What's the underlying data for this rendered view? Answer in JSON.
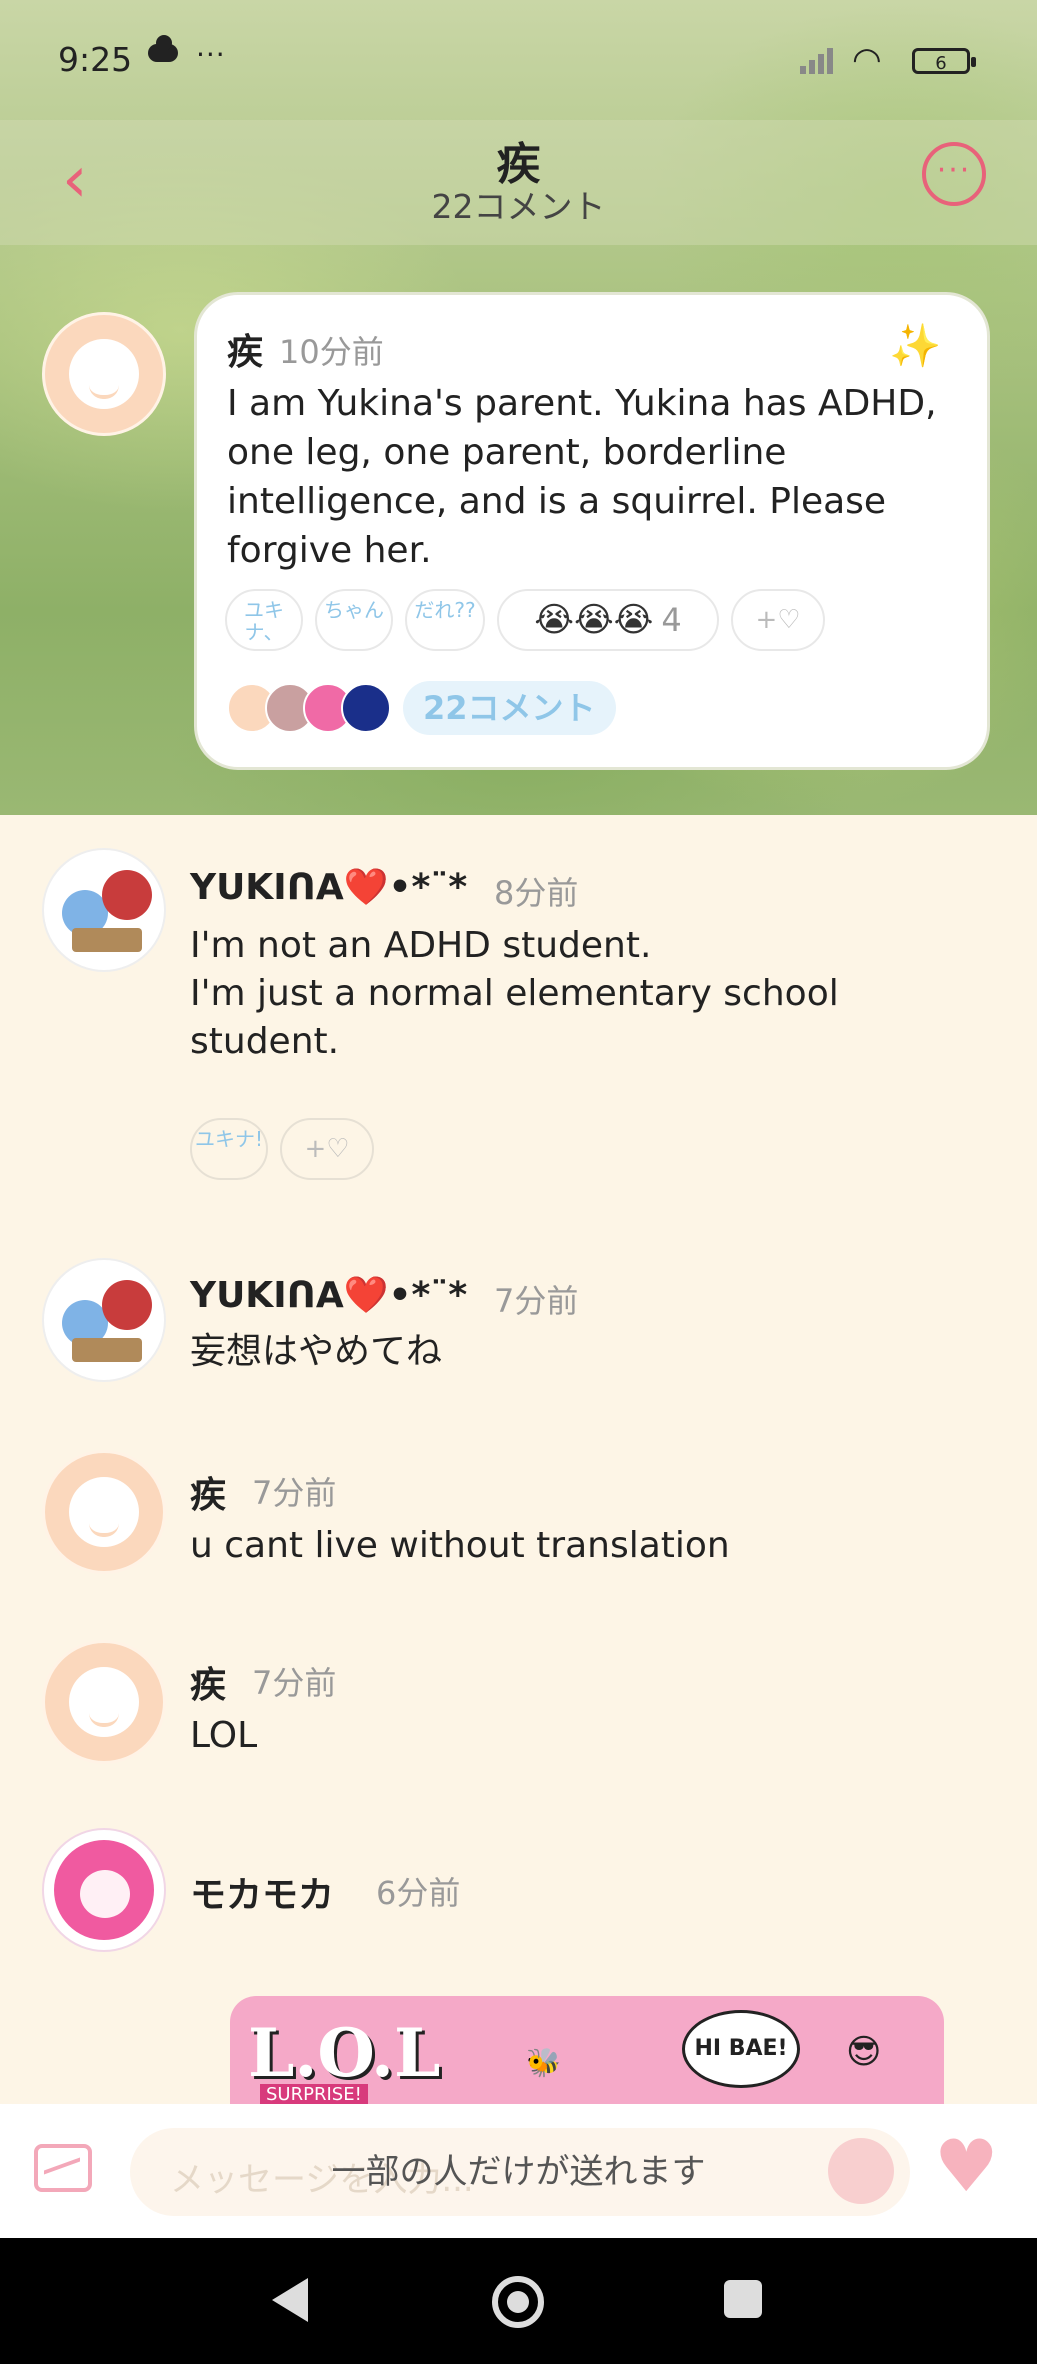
{
  "status_bar": {
    "time": "9:25",
    "more": "···",
    "battery": "6"
  },
  "header": {
    "title": "疾",
    "subtitle": "22コメント",
    "back_icon": "‹",
    "more_icon": "···"
  },
  "post": {
    "author": "疾",
    "time": "10分前",
    "sparkle": "✨",
    "text": "I am Yukina's parent. Yukina has ADHD, one leg, one parent, borderline intelligence, and is a squirrel. Please forgive her.",
    "chips": [
      "ユキナ、",
      "ちゃん",
      "だれ??"
    ],
    "reaction_emojis": "😭😭😭",
    "reaction_count": "4",
    "add_reaction": "+♡",
    "comment_button": "22コメント"
  },
  "comments": [
    {
      "name": "YUKIᑎA❤️•*¨*",
      "time": "8分前",
      "text": "I'm not an ADHD student.\nI'm just a normal elementary school student.",
      "chip": "ユキナ!",
      "add": "+♡"
    },
    {
      "name": "YUKIᑎA❤️•*¨*",
      "time": "7分前",
      "text": "妄想はやめてね"
    },
    {
      "name": "疾",
      "time": "7分前",
      "text": "u cant live without translation"
    },
    {
      "name": "疾",
      "time": "7分前",
      "text": "LOL"
    },
    {
      "name": "モカモカ",
      "time": "6分前"
    }
  ],
  "sticker": {
    "logo": "L.O.L",
    "tag": "SURPRISE!",
    "bubble": "HI BAE!"
  },
  "composer": {
    "placeholder": "メッセージを入力...",
    "notice": "一部の人だけが送れます",
    "heart_icon": "♥"
  },
  "colors": {
    "accent": "#e8627a",
    "link": "#8fc6e8",
    "background": "#fdf5e6"
  }
}
